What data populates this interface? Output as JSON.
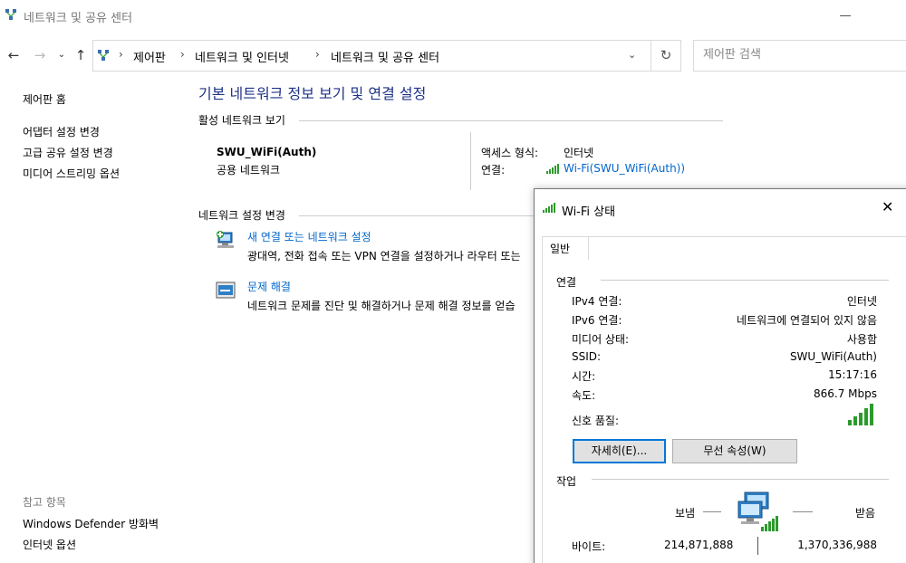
{
  "window": {
    "title": "네트워크 및 공유 센터"
  },
  "nav": {
    "back_icon": "back-arrow-icon",
    "forward_icon": "forward-arrow-icon",
    "recent_icon": "chevron-down-icon",
    "up_icon": "up-arrow-icon",
    "breadcrumb": [
      "제어판",
      "네트워크 및 인터넷",
      "네트워크 및 공유 센터"
    ],
    "search_placeholder": "제어판 검색"
  },
  "sidebar": {
    "home": "제어판 홈",
    "items": [
      "어댑터 설정 변경",
      "고급 공유 설정 변경",
      "미디어 스트리밍 옵션"
    ],
    "see_also_label": "참고 항목",
    "see_also": [
      "Windows Defender 방화벽",
      "인터넷 옵션"
    ]
  },
  "main": {
    "title": "기본 네트워크 정보 보기 및 연결 설정",
    "active_section": "활성 네트워크 보기",
    "network_name": "SWU_WiFi(Auth)",
    "network_type": "공용 네트워크",
    "access_type_label": "액세스 형식:",
    "access_type_value": "인터넷",
    "connection_label": "연결:",
    "connection_link": "Wi-Fi(SWU_WiFi(Auth))",
    "change_section": "네트워크 설정 변경",
    "tasks": [
      {
        "title": "새 연결 또는 네트워크 설정",
        "desc": "광대역, 전화 접속 또는 VPN 연결을 설정하거나 라우터 또는"
      },
      {
        "title": "문제 해결",
        "desc": "네트워크 문제를 진단 및 해결하거나 문제 해결 정보를 얻습"
      }
    ]
  },
  "dialog": {
    "title": "Wi-Fi 상태",
    "tab": "일반",
    "connection_group": "연결",
    "rows": [
      {
        "label": "IPv4 연결:",
        "value": "인터넷"
      },
      {
        "label": "IPv6 연결:",
        "value": "네트워크에 연결되어 있지 않음"
      },
      {
        "label": "미디어 상태:",
        "value": "사용함"
      },
      {
        "label": "SSID:",
        "value": "SWU_WiFi(Auth)"
      },
      {
        "label": "시간:",
        "value": "15:17:16"
      },
      {
        "label": "속도:",
        "value": "866.7 Mbps"
      }
    ],
    "signal_label": "신호 품질:",
    "signal_bars": 5,
    "details_button": "자세히(E)...",
    "wireless_button": "무선 속성(W)",
    "activity_group": "작업",
    "sent_label": "보냄",
    "received_label": "받음",
    "bytes_label": "바이트:",
    "bytes_sent": "214,871,888",
    "bytes_received": "1,370,336,988"
  },
  "colors": {
    "title_blue": "#1e3287",
    "link_blue": "#0066cc",
    "signal_green": "#2c9a2c",
    "focus_blue": "#0078d7"
  }
}
